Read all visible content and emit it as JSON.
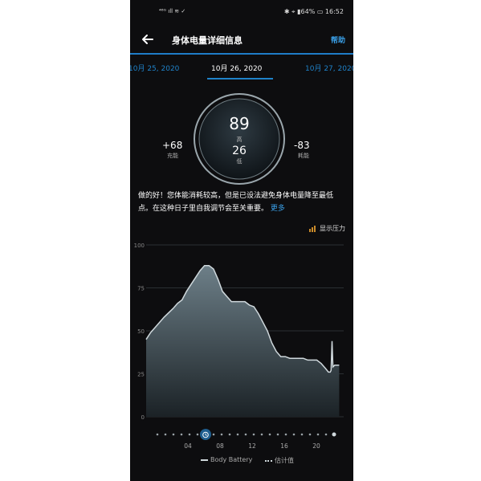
{
  "status_bar": {
    "left": "⁴⁶ᴳ ıll ≋ ✓",
    "right": "✱ ⌖ ▮64% ▭ 16:52"
  },
  "header": {
    "title": "身体电量详细信息",
    "help": "帮助"
  },
  "tabs": {
    "prev": "10月 25, 2020",
    "current": "10月 26, 2020",
    "next": "10月 27, 2020"
  },
  "gauge": {
    "high_value": "89",
    "high_label": "高",
    "low_value": "26",
    "low_label": "低"
  },
  "charged": {
    "value": "+68",
    "label": "充能"
  },
  "drained": {
    "value": "-83",
    "label": "耗能"
  },
  "message": {
    "text": "做的好！您体能消耗较高，但是已设法避免身体电量降至最低点。在这种日子里自我调节会至关重要。",
    "more": "更多"
  },
  "stress_toggle": {
    "label": "显示压力"
  },
  "chart_data": {
    "type": "area",
    "ylim": [
      0,
      100
    ],
    "yticks": [
      "0",
      "25",
      "50",
      "75",
      "100"
    ],
    "x": [
      0,
      0.5,
      1,
      2,
      3,
      3.5,
      4,
      4.5,
      5,
      5.5,
      6,
      6.5,
      7,
      7.5,
      8,
      8.5,
      9,
      9.5,
      10,
      10.5,
      11,
      11.5,
      12,
      12.5,
      13,
      13.5,
      14,
      14.5,
      15,
      15.5,
      16,
      16.5,
      17,
      17.5,
      18,
      18.5,
      19,
      19.5,
      20,
      20.3,
      20.5,
      20.6,
      20.7,
      20.8,
      21,
      21.5
    ],
    "values": [
      45,
      49,
      52,
      58,
      63,
      66,
      68,
      73,
      77,
      81,
      85,
      88,
      88,
      86,
      80,
      73,
      70,
      67,
      67,
      67,
      67,
      65,
      64,
      60,
      55,
      50,
      43,
      38,
      35,
      35,
      34,
      34,
      34,
      34,
      33,
      33,
      33,
      31,
      28,
      26,
      26,
      27,
      44,
      29,
      30,
      30
    ],
    "series_color": "#cfd8dc"
  },
  "timeline": {
    "labels": [
      "04",
      "08",
      "12",
      "16",
      "20"
    ],
    "alarm_icon": "alarm-clock-icon"
  },
  "legend": {
    "body_battery": "Body Battery",
    "estimated": "估计值"
  },
  "colors": {
    "accent": "#1f82c9",
    "background": "#0d0d0f"
  }
}
